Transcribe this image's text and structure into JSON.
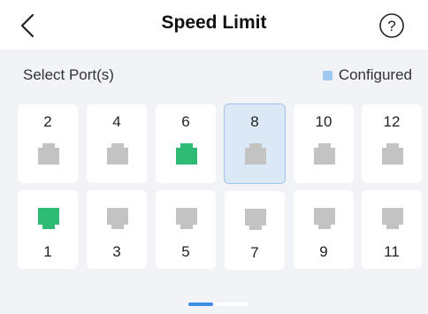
{
  "header": {
    "title": "Speed Limit"
  },
  "section": {
    "label": "Select Port(s)",
    "legend_label": "Configured"
  },
  "colors": {
    "port_default": "#c3c3c3",
    "port_linked": "#2ebb73",
    "selected_bg": "#dbe9f7",
    "configured_swatch": "#9fc9ee",
    "pager_active": "#3e8ee6"
  },
  "ports_top": [
    {
      "label": "2",
      "state": "default"
    },
    {
      "label": "4",
      "state": "default"
    },
    {
      "label": "6",
      "state": "linked"
    },
    {
      "label": "8",
      "state": "selected"
    },
    {
      "label": "10",
      "state": "default"
    },
    {
      "label": "12",
      "state": "default"
    }
  ],
  "ports_bottom": [
    {
      "label": "1",
      "state": "linked"
    },
    {
      "label": "3",
      "state": "default"
    },
    {
      "label": "5",
      "state": "default"
    },
    {
      "label": "7",
      "state": "default"
    },
    {
      "label": "9",
      "state": "default"
    },
    {
      "label": "11",
      "state": "default"
    }
  ],
  "pager": {
    "pages": 2,
    "current": 1
  }
}
